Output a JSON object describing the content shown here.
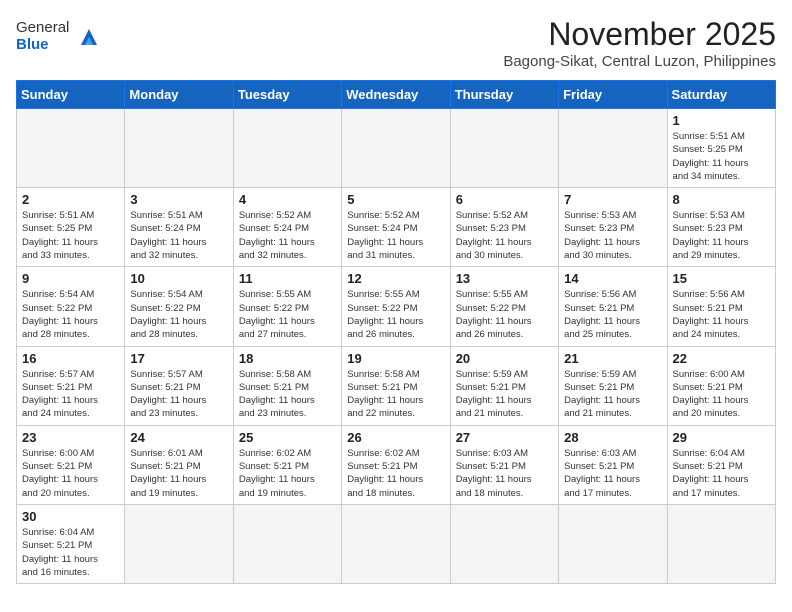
{
  "header": {
    "logo_general": "General",
    "logo_blue": "Blue",
    "month_title": "November 2025",
    "location": "Bagong-Sikat, Central Luzon, Philippines"
  },
  "days_of_week": [
    "Sunday",
    "Monday",
    "Tuesday",
    "Wednesday",
    "Thursday",
    "Friday",
    "Saturday"
  ],
  "weeks": [
    [
      {
        "day": "",
        "info": ""
      },
      {
        "day": "",
        "info": ""
      },
      {
        "day": "",
        "info": ""
      },
      {
        "day": "",
        "info": ""
      },
      {
        "day": "",
        "info": ""
      },
      {
        "day": "",
        "info": ""
      },
      {
        "day": "1",
        "info": "Sunrise: 5:51 AM\nSunset: 5:25 PM\nDaylight: 11 hours\nand 34 minutes."
      }
    ],
    [
      {
        "day": "2",
        "info": "Sunrise: 5:51 AM\nSunset: 5:25 PM\nDaylight: 11 hours\nand 33 minutes."
      },
      {
        "day": "3",
        "info": "Sunrise: 5:51 AM\nSunset: 5:24 PM\nDaylight: 11 hours\nand 32 minutes."
      },
      {
        "day": "4",
        "info": "Sunrise: 5:52 AM\nSunset: 5:24 PM\nDaylight: 11 hours\nand 32 minutes."
      },
      {
        "day": "5",
        "info": "Sunrise: 5:52 AM\nSunset: 5:24 PM\nDaylight: 11 hours\nand 31 minutes."
      },
      {
        "day": "6",
        "info": "Sunrise: 5:52 AM\nSunset: 5:23 PM\nDaylight: 11 hours\nand 30 minutes."
      },
      {
        "day": "7",
        "info": "Sunrise: 5:53 AM\nSunset: 5:23 PM\nDaylight: 11 hours\nand 30 minutes."
      },
      {
        "day": "8",
        "info": "Sunrise: 5:53 AM\nSunset: 5:23 PM\nDaylight: 11 hours\nand 29 minutes."
      }
    ],
    [
      {
        "day": "9",
        "info": "Sunrise: 5:54 AM\nSunset: 5:22 PM\nDaylight: 11 hours\nand 28 minutes."
      },
      {
        "day": "10",
        "info": "Sunrise: 5:54 AM\nSunset: 5:22 PM\nDaylight: 11 hours\nand 28 minutes."
      },
      {
        "day": "11",
        "info": "Sunrise: 5:55 AM\nSunset: 5:22 PM\nDaylight: 11 hours\nand 27 minutes."
      },
      {
        "day": "12",
        "info": "Sunrise: 5:55 AM\nSunset: 5:22 PM\nDaylight: 11 hours\nand 26 minutes."
      },
      {
        "day": "13",
        "info": "Sunrise: 5:55 AM\nSunset: 5:22 PM\nDaylight: 11 hours\nand 26 minutes."
      },
      {
        "day": "14",
        "info": "Sunrise: 5:56 AM\nSunset: 5:21 PM\nDaylight: 11 hours\nand 25 minutes."
      },
      {
        "day": "15",
        "info": "Sunrise: 5:56 AM\nSunset: 5:21 PM\nDaylight: 11 hours\nand 24 minutes."
      }
    ],
    [
      {
        "day": "16",
        "info": "Sunrise: 5:57 AM\nSunset: 5:21 PM\nDaylight: 11 hours\nand 24 minutes."
      },
      {
        "day": "17",
        "info": "Sunrise: 5:57 AM\nSunset: 5:21 PM\nDaylight: 11 hours\nand 23 minutes."
      },
      {
        "day": "18",
        "info": "Sunrise: 5:58 AM\nSunset: 5:21 PM\nDaylight: 11 hours\nand 23 minutes."
      },
      {
        "day": "19",
        "info": "Sunrise: 5:58 AM\nSunset: 5:21 PM\nDaylight: 11 hours\nand 22 minutes."
      },
      {
        "day": "20",
        "info": "Sunrise: 5:59 AM\nSunset: 5:21 PM\nDaylight: 11 hours\nand 21 minutes."
      },
      {
        "day": "21",
        "info": "Sunrise: 5:59 AM\nSunset: 5:21 PM\nDaylight: 11 hours\nand 21 minutes."
      },
      {
        "day": "22",
        "info": "Sunrise: 6:00 AM\nSunset: 5:21 PM\nDaylight: 11 hours\nand 20 minutes."
      }
    ],
    [
      {
        "day": "23",
        "info": "Sunrise: 6:00 AM\nSunset: 5:21 PM\nDaylight: 11 hours\nand 20 minutes."
      },
      {
        "day": "24",
        "info": "Sunrise: 6:01 AM\nSunset: 5:21 PM\nDaylight: 11 hours\nand 19 minutes."
      },
      {
        "day": "25",
        "info": "Sunrise: 6:02 AM\nSunset: 5:21 PM\nDaylight: 11 hours\nand 19 minutes."
      },
      {
        "day": "26",
        "info": "Sunrise: 6:02 AM\nSunset: 5:21 PM\nDaylight: 11 hours\nand 18 minutes."
      },
      {
        "day": "27",
        "info": "Sunrise: 6:03 AM\nSunset: 5:21 PM\nDaylight: 11 hours\nand 18 minutes."
      },
      {
        "day": "28",
        "info": "Sunrise: 6:03 AM\nSunset: 5:21 PM\nDaylight: 11 hours\nand 17 minutes."
      },
      {
        "day": "29",
        "info": "Sunrise: 6:04 AM\nSunset: 5:21 PM\nDaylight: 11 hours\nand 17 minutes."
      }
    ],
    [
      {
        "day": "30",
        "info": "Sunrise: 6:04 AM\nSunset: 5:21 PM\nDaylight: 11 hours\nand 16 minutes."
      },
      {
        "day": "",
        "info": ""
      },
      {
        "day": "",
        "info": ""
      },
      {
        "day": "",
        "info": ""
      },
      {
        "day": "",
        "info": ""
      },
      {
        "day": "",
        "info": ""
      },
      {
        "day": "",
        "info": ""
      }
    ]
  ]
}
